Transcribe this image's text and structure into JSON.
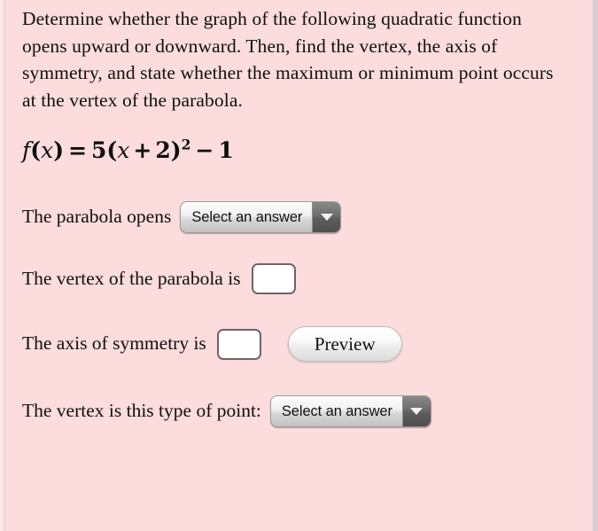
{
  "page": {
    "background_color": "#fcdcdc",
    "left_edge_color": "#f7e9ea",
    "right_edge_color": "#d9ccd2"
  },
  "prompt": {
    "text": "Determine whether the graph of the following quadratic function opens upward or downward. Then, find the vertex, the axis of symmetry, and state whether the maximum or minimum point occurs at the vertex of the parabola."
  },
  "equation": {
    "plain": "f(x) = 5(x + 2)^2 - 1",
    "function_name": "f",
    "variable": "x",
    "leading_coefficient": "5",
    "open_paren": "(",
    "inner_operator": "+",
    "inner_constant": "2",
    "close_paren": ")",
    "exponent": "2",
    "trailing_operator": "−",
    "trailing_constant": "1",
    "equals": "="
  },
  "rows": {
    "opens": {
      "label": "The parabola opens",
      "select_value": "Select an answer"
    },
    "vertex": {
      "label": "The vertex of the parabola is",
      "input_value": "",
      "input_placeholder": ""
    },
    "axis": {
      "label": "The axis of symmetry is",
      "input_value": "",
      "input_placeholder": "",
      "preview_label": "Preview"
    },
    "type": {
      "label": "The vertex is this type of point:",
      "select_value": "Select an answer"
    }
  }
}
